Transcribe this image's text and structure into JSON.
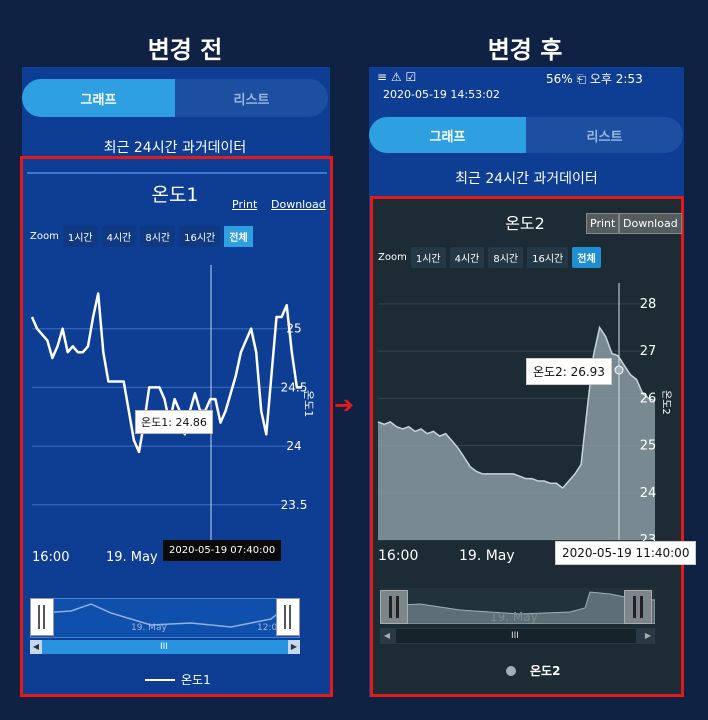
{
  "headings": {
    "before": "변경 전",
    "after": "변경 후"
  },
  "tabs": {
    "graph": "그래프",
    "list": "리스트"
  },
  "subtitle": "최근 24시간 과거데이터",
  "status_bar": {
    "left_icons": "≡ ⚠ ☑",
    "right": "56% ⎗ 오후 2:53",
    "datetime": "2020-05-19 14:53:02"
  },
  "left_chart": {
    "title": "온도1",
    "print": "Print",
    "download": "Download",
    "zoom_label": "Zoom",
    "zoom_buttons": [
      "1시간",
      "4시간",
      "8시간",
      "16시간",
      "전체"
    ],
    "tooltip": "온도1: 24.86",
    "x_tooltip": "2020-05-19 07:40:00",
    "x_labels": [
      "16:00",
      "19. May"
    ],
    "y_labels": [
      "25",
      "24.5",
      "24",
      "23.5"
    ],
    "y_title": "온도1",
    "nav_label": "19. May",
    "nav_label2": "12:00",
    "scroll_grip": "III",
    "legend": "온도1",
    "line_color": "#ffffff",
    "bg_color": "#0d3e94"
  },
  "right_chart": {
    "title": "온도2",
    "print": "Print",
    "download": "Download",
    "zoom_label": "Zoom",
    "zoom_buttons": [
      "1시간",
      "4시간",
      "8시간",
      "16시간",
      "전체"
    ],
    "tooltip": "온도2: 26.93",
    "x_tooltip": "2020-05-19 11:40:00",
    "x_labels": [
      "16:00",
      "19. May"
    ],
    "y_labels": [
      "28",
      "27",
      "26",
      "25",
      "24",
      "23"
    ],
    "y_title": "온도2",
    "nav_label": "19. May",
    "scroll_grip": "III",
    "legend": "온도2",
    "bg_color": "#1d2b34",
    "area_color": "#8a9aa2"
  },
  "chart_data": [
    {
      "type": "line",
      "title": "온도1",
      "ylabel": "온도1",
      "ylim": [
        23.2,
        25.5
      ],
      "y_ticks": [
        23.5,
        24,
        24.5,
        25
      ],
      "series": [
        {
          "name": "온도1",
          "values": [
            25.1,
            25.0,
            24.95,
            24.9,
            24.75,
            24.85,
            25.0,
            24.8,
            24.85,
            24.8,
            24.8,
            24.85,
            25.1,
            25.3,
            24.8,
            24.55,
            24.55,
            24.55,
            24.55,
            24.3,
            24.05,
            23.95,
            24.2,
            24.5,
            24.5,
            24.5,
            24.4,
            24.2,
            24.4,
            24.3,
            24.1,
            24.3,
            24.45,
            24.3,
            24.3,
            24.4,
            24.4,
            24.2,
            24.3,
            24.45,
            24.6,
            24.8,
            24.9,
            25.0,
            24.8,
            24.3,
            24.1,
            24.6,
            25.1,
            25.1,
            25.2,
            24.8,
            24.5,
            24.5
          ]
        }
      ],
      "x_labels": [
        "16:00",
        "19. May"
      ],
      "legend": "bottom-center"
    },
    {
      "type": "area",
      "title": "온도2",
      "ylabel": "온도2",
      "ylim": [
        23,
        28.4
      ],
      "y_ticks": [
        23,
        24,
        25,
        26,
        27,
        28
      ],
      "series": [
        {
          "name": "온도2",
          "values": [
            25.5,
            25.45,
            25.5,
            25.4,
            25.35,
            25.4,
            25.3,
            25.35,
            25.25,
            25.3,
            25.2,
            25.25,
            25.1,
            24.95,
            24.75,
            24.55,
            24.45,
            24.4,
            24.4,
            24.4,
            24.4,
            24.4,
            24.4,
            24.35,
            24.3,
            24.3,
            24.25,
            24.25,
            24.2,
            24.2,
            24.1,
            24.25,
            24.4,
            24.6,
            25.8,
            26.9,
            27.5,
            27.3,
            26.95,
            26.9,
            26.7,
            26.5,
            26.4,
            26.1,
            26.0,
            25.95
          ]
        }
      ],
      "x_labels": [
        "16:00",
        "19. May"
      ],
      "legend": "bottom-center"
    }
  ]
}
